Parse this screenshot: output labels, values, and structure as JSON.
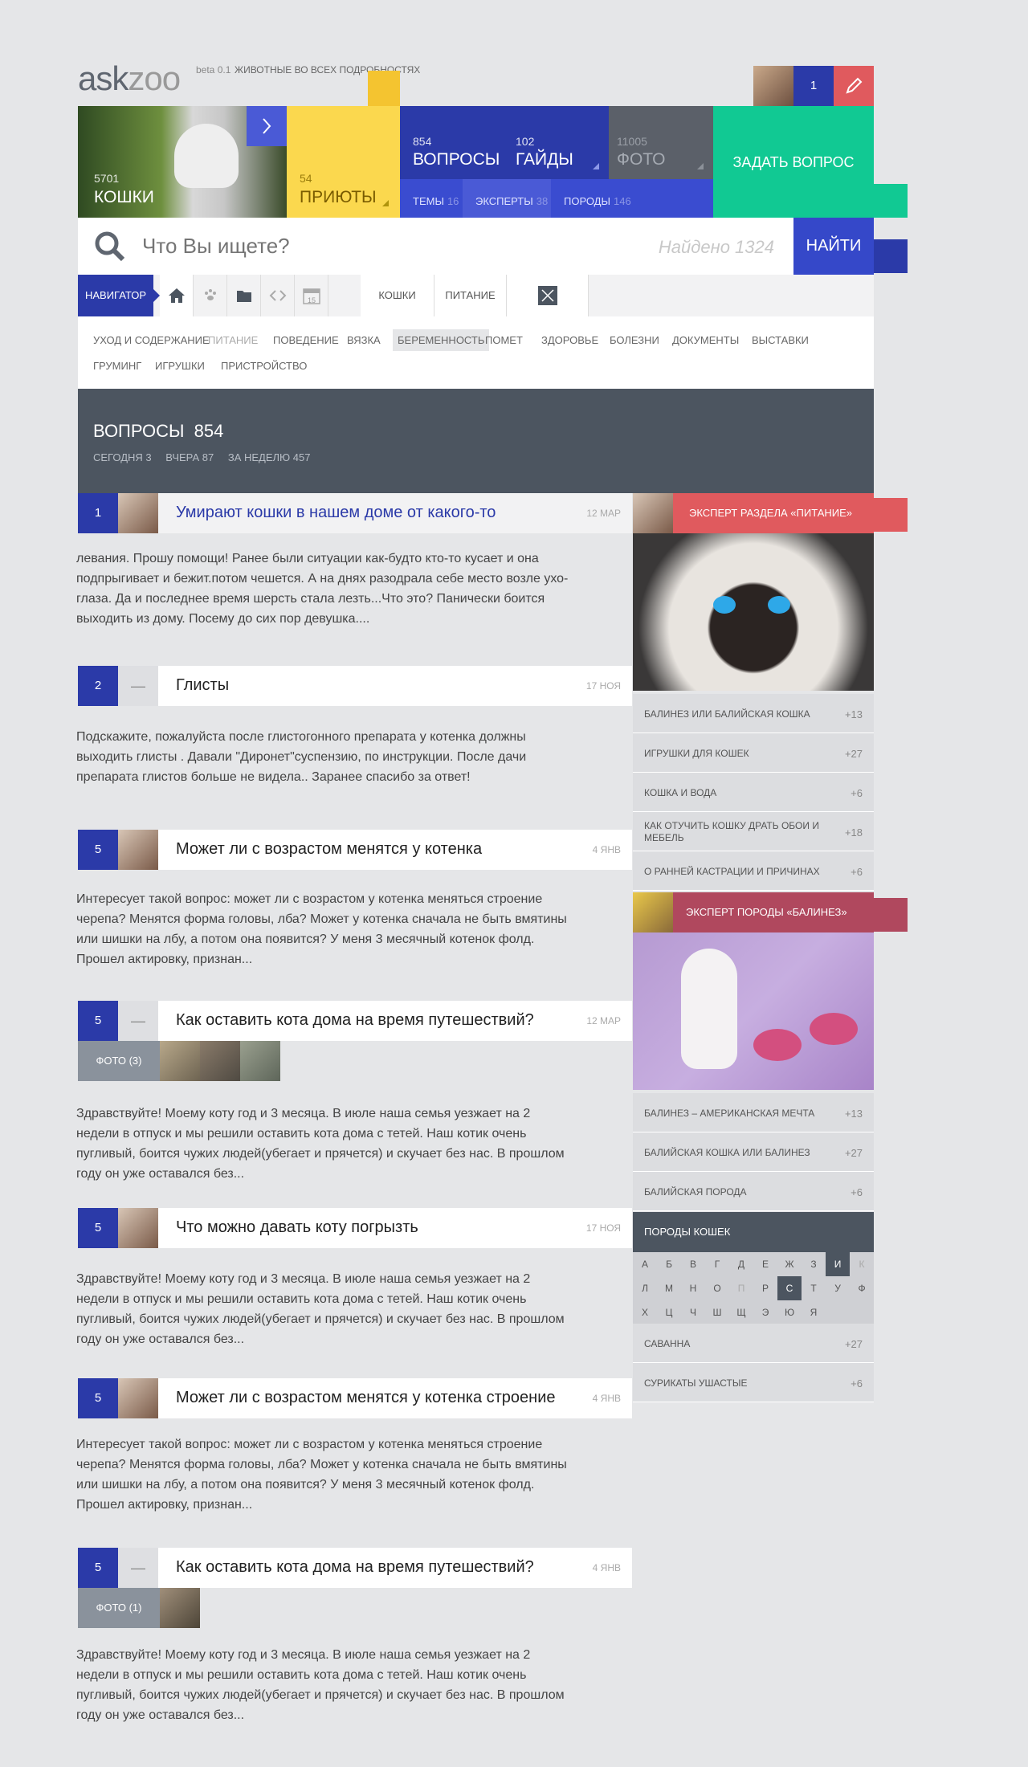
{
  "header": {
    "logo_ask": "ask",
    "logo_zoo": "zoo",
    "beta": "beta 0.1",
    "tagline": "ЖИВОТНЫЕ ВО ВСЕХ ПОДРОБНОСТЯХ",
    "notifications": "1"
  },
  "tiles": {
    "cats": {
      "num": "5701",
      "label": "КОШКИ"
    },
    "shelters": {
      "num": "54",
      "label": "ПРИЮТЫ"
    },
    "questions": {
      "num": "854",
      "label": "ВОПРОСЫ"
    },
    "guides": {
      "num": "102",
      "label": "ГАЙДЫ"
    },
    "photo": {
      "num": "11005",
      "label": "ФОТО"
    },
    "ask": {
      "label": "ЗАДАТЬ ВОПРОС"
    },
    "topics": {
      "label": "ТЕМЫ",
      "count": "16"
    },
    "experts": {
      "label": "ЭКСПЕРТЫ",
      "count": "38"
    },
    "breeds": {
      "label": "ПОРОДЫ",
      "count": "146"
    }
  },
  "search": {
    "placeholder": "Что Вы ищете?",
    "found": "Найдено 1324",
    "button": "НАЙТИ"
  },
  "nav": {
    "navigator": "НАВИГАТОР",
    "date_num": "15",
    "tag1": "КОШКИ",
    "tag2": "ПИТАНИЕ"
  },
  "categories": [
    "УХОД И СОДЕРЖАНИЕ",
    "ПИТАНИЕ",
    "ПОВЕДЕНИЕ",
    "ВЯЗКА",
    "БЕРЕМЕННОСТЬ",
    "ПОМЕТ",
    "ЗДОРОВЬЕ",
    "БОЛЕЗНИ",
    "ДОКУМЕНТЫ",
    "ВЫСТАВКИ",
    "ГРУМИНГ",
    "ИГРУШКИ",
    "ПРИСТРОЙСТВО"
  ],
  "questions_header": {
    "title": "ВОПРОСЫ",
    "count": "854",
    "today": "СЕГОДНЯ 3",
    "yesterday": "ВЧЕРА 87",
    "week": "ЗА НЕДЕЛЮ 457"
  },
  "questions": [
    {
      "num": "1",
      "title": "Умирают кошки в нашем доме от какого-то",
      "date": "12 МАР",
      "text": "левания. Прошу помощи! Ранее были ситуации как-будто кто-то кусает и она подпрыгивает и бежит.потом чешется. А на днях разодрала себе место возле ухо-глаза. Да и последнее время шерсть стала лезть...Что это? Панически боится выходить из дому. Посему до сих пор девушка...."
    },
    {
      "num": "2",
      "dash": "—",
      "title": "Глисты",
      "date": "17 НОЯ",
      "text": "Подскажите, пожалуйста после глистогонного препарата у котенка должны выходить глисты . Давали \"Диронет\"суспензию, по инструкции. После дачи препарата глистов больше не видела.. Заранее спасибо за ответ!"
    },
    {
      "num": "5",
      "title": "Может ли с возрастом менятся у котенка",
      "date": "4 ЯНВ",
      "text": "Интересует такой вопрос: может ли с возрастом у котенка меняться строение черепа? Менятся форма головы, лба? Может у котенка сначала не быть вмятины или шишки на лбу, а потом она появится? У меня 3 месячный котенок фолд. Прошел актировку, признан..."
    },
    {
      "num": "5",
      "dash": "—",
      "title": "Как оставить кота дома на время путешествий?",
      "date": "12 МАР",
      "photos": "ФОТО (3)",
      "text": "Здравствуйте! Моему коту год и 3 месяца. В июле наша семья уезжает на 2 недели в отпуск и мы решили оставить кота дома с тетей. Наш котик очень пугливый, боится чужих людей(убегает и прячется) и скучает без нас. В прошлом году он уже оставался без..."
    },
    {
      "num": "5",
      "title": "Что можно давать коту погрызть",
      "date": "17 НОЯ",
      "text": "Здравствуйте! Моему коту год и 3 месяца. В июле наша семья уезжает на 2 недели в отпуск и мы решили оставить кота дома с тетей. Наш котик очень пугливый, боится чужих людей(убегает и прячется) и скучает без нас. В прошлом году он уже оставался без..."
    },
    {
      "num": "5",
      "title": "Может ли с возрастом менятся у котенка строение",
      "date": "4 ЯНВ",
      "text": "Интересует такой вопрос: может ли с возрастом у котенка меняться строение черепа? Менятся форма головы, лба? Может у котенка сначала не быть вмятины или шишки на лбу, а потом она появится? У меня 3 месячный котенок фолд. Прошел актировку, признан..."
    },
    {
      "num": "5",
      "dash": "—",
      "title": "Как оставить кота дома на время путешествий?",
      "date": "4 ЯНВ",
      "photos": "ФОТО (1)",
      "text": "Здравствуйте! Моему коту год и 3 месяца. В июле наша семья уезжает на 2 недели в отпуск и мы решили оставить кота дома с тетей. Наш котик очень пугливый, боится чужих людей(убегает и прячется) и скучает без нас. В прошлом году он уже оставался без..."
    }
  ],
  "sidebar": {
    "expert1": "ЭКСПЕРТ РАЗДЕЛА «ПИТАНИЕ»",
    "list1": [
      {
        "t": "БАЛИНЕЗ ИЛИ БАЛИЙСКАЯ КОШКА",
        "c": "+13"
      },
      {
        "t": "ИГРУШКИ ДЛЯ КОШЕК",
        "c": "+27"
      },
      {
        "t": "КОШКА И ВОДА",
        "c": "+6"
      },
      {
        "t": "КАК ОТУЧИТЬ КОШКУ ДРАТЬ ОБОИ И МЕБЕЛЬ",
        "c": "+18"
      },
      {
        "t": "О РАННЕЙ КАСТРАЦИИ И ПРИЧИНАХ",
        "c": "+6"
      }
    ],
    "expert2": "ЭКСПЕРТ ПОРОДЫ «БАЛИНЕЗ»",
    "list2": [
      {
        "t": "БАЛИНЕЗ – АМЕРИКАНСКАЯ МЕЧТА",
        "c": "+13"
      },
      {
        "t": "БАЛИЙСКАЯ КОШКА ИЛИ БАЛИНЕЗ",
        "c": "+27"
      },
      {
        "t": "БАЛИЙСКАЯ ПОРОДА",
        "c": "+6"
      }
    ],
    "breeds_title": "ПОРОДЫ КОШЕК",
    "alphabet": [
      "А",
      "Б",
      "В",
      "Г",
      "Д",
      "Е",
      "Ж",
      "З",
      "И",
      "К",
      "Л",
      "М",
      "Н",
      "О",
      "П",
      "Р",
      "С",
      "Т",
      "У",
      "Ф",
      "Х",
      "Ц",
      "Ч",
      "Ш",
      "Щ",
      "Э",
      "Ю",
      "Я"
    ],
    "list3": [
      {
        "t": "САВАННА",
        "c": "+27"
      },
      {
        "t": "СУРИКАТЫ УШАСТЫЕ",
        "c": "+6"
      }
    ]
  },
  "colors": {
    "blue": "#2b3aa8",
    "yellow": "#fbd84e",
    "green": "#11c993",
    "red": "#e05a5e",
    "slate": "#4c5560",
    "grey": "#5b6069"
  }
}
